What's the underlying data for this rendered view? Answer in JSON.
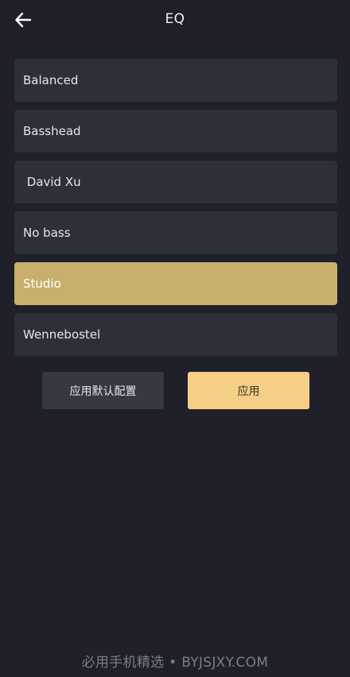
{
  "header": {
    "title": "EQ"
  },
  "presets": [
    {
      "label": "Balanced"
    },
    {
      "label": "Basshead"
    },
    {
      "label": " David Xu"
    },
    {
      "label": "No bass"
    },
    {
      "label": "Studio"
    },
    {
      "label": "Wennebostel"
    }
  ],
  "selected_preset": "Studio",
  "actions": {
    "default_label": "应用默认配置",
    "apply_label": "应用"
  },
  "watermark": "必用手机精选 • BYJSJXY.COM",
  "colors": {
    "background": "#1f2029",
    "item": "#2d3039",
    "selected": "#c8af6b",
    "apply": "#f5cf86"
  },
  "icons": {
    "back": "arrow-left-icon"
  }
}
